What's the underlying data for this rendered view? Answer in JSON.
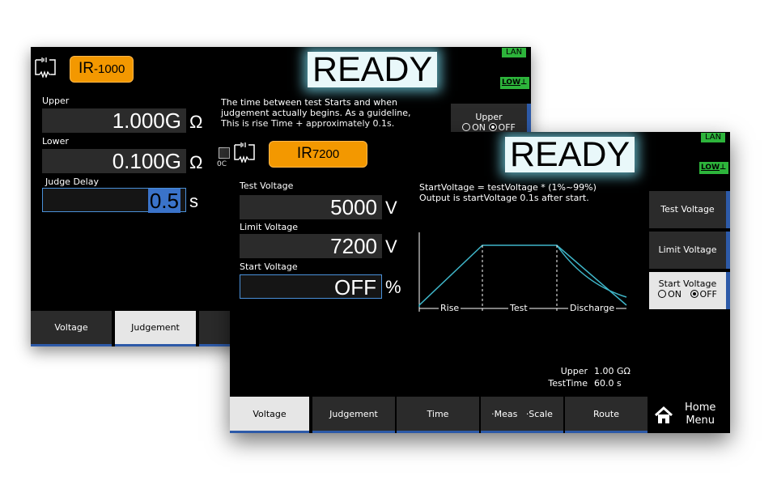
{
  "back": {
    "model": {
      "main": "IR",
      "sub": "-1000"
    },
    "status": "READY",
    "lan": "LAN",
    "low": "LOW",
    "fields": [
      {
        "label": "Upper",
        "value": "1.000G",
        "unit": "Ω"
      },
      {
        "label": "Lower",
        "value": "0.100G",
        "unit": "Ω"
      },
      {
        "label": "Judge Delay",
        "value": "0.5",
        "unit": "s"
      }
    ],
    "description": [
      "The time between test Starts and when",
      "judgement actually begins. As a guideline,",
      "This is rise Time + approximately 0.1s."
    ],
    "side_button": {
      "label": "Upper",
      "on": "ON",
      "off": "OFF"
    },
    "partial_text": "0C",
    "tabs": [
      "Voltage",
      "Judgement"
    ]
  },
  "front": {
    "model": {
      "main": "IR",
      "sub": "7200"
    },
    "status": "READY",
    "lan": "LAN",
    "low": "LOW",
    "fields": [
      {
        "label": "Test Voltage",
        "value": "5000",
        "unit": "V"
      },
      {
        "label": "Limit Voltage",
        "value": "7200",
        "unit": "V"
      },
      {
        "label": "Start Voltage",
        "value": "OFF",
        "unit": "%"
      }
    ],
    "description": [
      "StartVoltage = testVoltage * (1%~99%)",
      "Output is startVoltage 0.1s after start."
    ],
    "graph_labels": {
      "rise": "Rise",
      "test": "Test",
      "discharge": "Discharge"
    },
    "side_buttons": [
      {
        "label": "Test Voltage"
      },
      {
        "label": "Limit Voltage"
      },
      {
        "label": "Start Voltage",
        "on": "ON",
        "off": "OFF"
      }
    ],
    "info": {
      "upper_label": "Upper",
      "upper_value": "1.00 GΩ",
      "time_label": "TestTime",
      "time_value": "60.0 s"
    },
    "tabs": [
      "Voltage",
      "Judgement",
      "Time",
      "·Meas",
      "·Scale",
      "Route"
    ],
    "home": {
      "line1": "Home",
      "line2": "Menu"
    }
  },
  "colors": {
    "accent": "#f39800",
    "tab_blue": "#2d5aa8",
    "graph": "#3fb6c9",
    "lan": "#2db43b"
  }
}
